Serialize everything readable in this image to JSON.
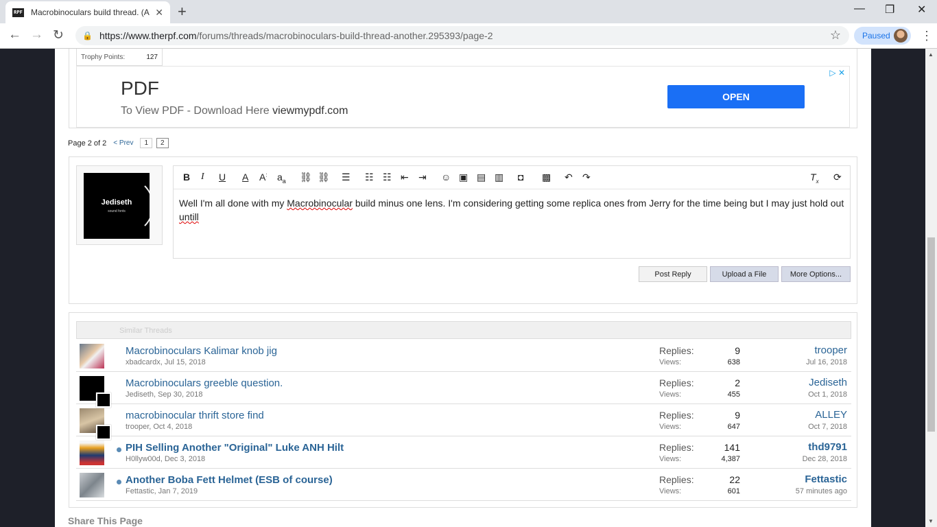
{
  "browser": {
    "tab_title": "Macrobinoculars build thread. (A",
    "favicon_text": "RPF",
    "url_host": "https://www.therpf.com",
    "url_path": "/forums/threads/macrobinoculars-build-thread-another.295393/page-2",
    "profile_label": "Paused"
  },
  "trophy": {
    "label": "Trophy Points:",
    "value": "127"
  },
  "ad": {
    "title": "PDF",
    "subtitle": "To View PDF - Download Here",
    "domain": "viewmypdf.com",
    "button": "OPEN"
  },
  "pagenav": {
    "label": "Page 2 of 2",
    "prev": "< Prev",
    "pages": [
      "1",
      "2"
    ]
  },
  "reply": {
    "avatar_name": "Jediseth",
    "avatar_sub": "sound fonts",
    "text_before": "Well I'm all done with my ",
    "text_misspelled1": "Macrobinocular",
    "text_middle": " build minus one lens. I'm considering getting some replica ones from Jerry for the time being but I may just hold out ",
    "text_misspelled2": "untill",
    "buttons": {
      "post": "Post Reply",
      "upload": "Upload a File",
      "more": "More Options..."
    }
  },
  "similar": {
    "header": "Similar Threads",
    "replies_label": "Replies:",
    "views_label": "Views:",
    "rows": [
      {
        "title": "Macrobinoculars Kalimar knob jig",
        "author": "xbadcardx, Jul 15, 2018",
        "replies": "9",
        "views": "638",
        "last_poster": "trooper",
        "last_date": "Jul 16, 2018"
      },
      {
        "title": "Macrobinoculars greeble question.",
        "author": "Jediseth, Sep 30, 2018",
        "replies": "2",
        "views": "455",
        "last_poster": "Jediseth",
        "last_date": "Oct 1, 2018"
      },
      {
        "title": "macrobinocular thrift store find",
        "author": "trooper, Oct 4, 2018",
        "replies": "9",
        "views": "647",
        "last_poster": "ALLEY",
        "last_date": "Oct 7, 2018"
      },
      {
        "title": "PIH Selling Another \"Original\" Luke ANH Hilt",
        "author": "H0llyw00d, Dec 3, 2018",
        "replies": "141",
        "views": "4,387",
        "last_poster": "thd9791",
        "last_date": "Dec 28, 2018"
      },
      {
        "title": "Another Boba Fett Helmet (ESB of course)",
        "author": "Fettastic, Jan 7, 2019",
        "replies": "22",
        "views": "601",
        "last_poster": "Fettastic",
        "last_date": "57 minutes ago"
      }
    ]
  },
  "share": "Share This Page"
}
